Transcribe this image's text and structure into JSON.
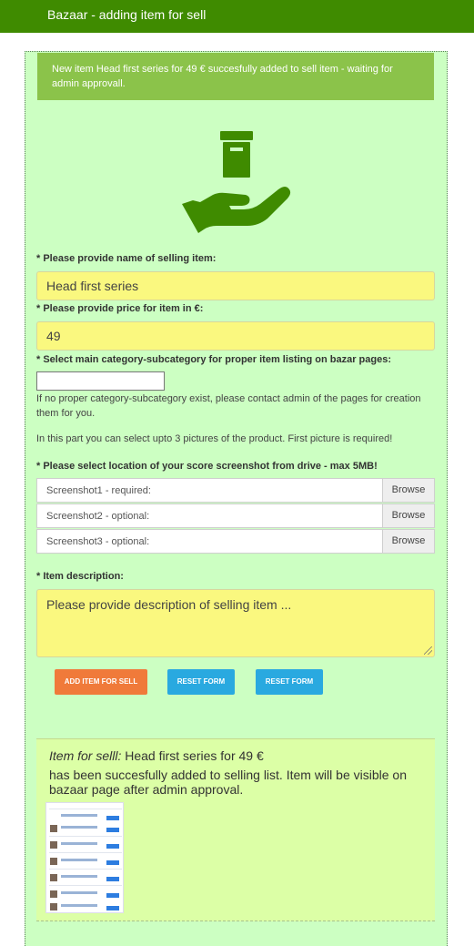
{
  "header": {
    "title": "Bazaar - adding item for sell"
  },
  "alert": {
    "message": "New item Head first series for 49 € succesfully added to sell item - waiting for admin approvall."
  },
  "form": {
    "name_label": "* Please provide name of selling item:",
    "name_value": "Head first series",
    "price_label": "* Please provide price for item in €:",
    "price_value": "49",
    "category_label": "* Select main category-subcategory for proper item listing on bazar pages:",
    "category_value": "",
    "category_help": "If no proper category-subcategory exist, please contact admin of the pages for creation them for you.",
    "pictures_help": "In this part you can select upto 3 pictures of the product. First picture is required!",
    "screenshot_label": "* Please select location of your score screenshot from drive - max 5MB!",
    "files": [
      {
        "placeholder": "Screenshot1 - required:",
        "browse": "Browse"
      },
      {
        "placeholder": "Screenshot2 - optional:",
        "browse": "Browse"
      },
      {
        "placeholder": "Screenshot3 - optional:",
        "browse": "Browse"
      }
    ],
    "description_label": "* Item description:",
    "description_placeholder": "Please provide description of selling item ...",
    "buttons": {
      "add": "ADD ITEM FOR SELL",
      "reset1": "RESET FORM",
      "reset2": "RESET FORM"
    }
  },
  "result": {
    "prefix": "Item for selll:",
    "item_text": " Head first series for 49 €",
    "message": "has been succesfully added to selling list. Item will be visible on bazaar page after admin approval."
  },
  "colors": {
    "header": "#3f8b00",
    "alert": "#8bc34a",
    "panel": "#ccffc2",
    "field": "#faf87f",
    "add_button": "#f07a3a",
    "reset_button": "#29a9e0"
  },
  "icons": {
    "hero": "hand-holding-box-icon"
  }
}
